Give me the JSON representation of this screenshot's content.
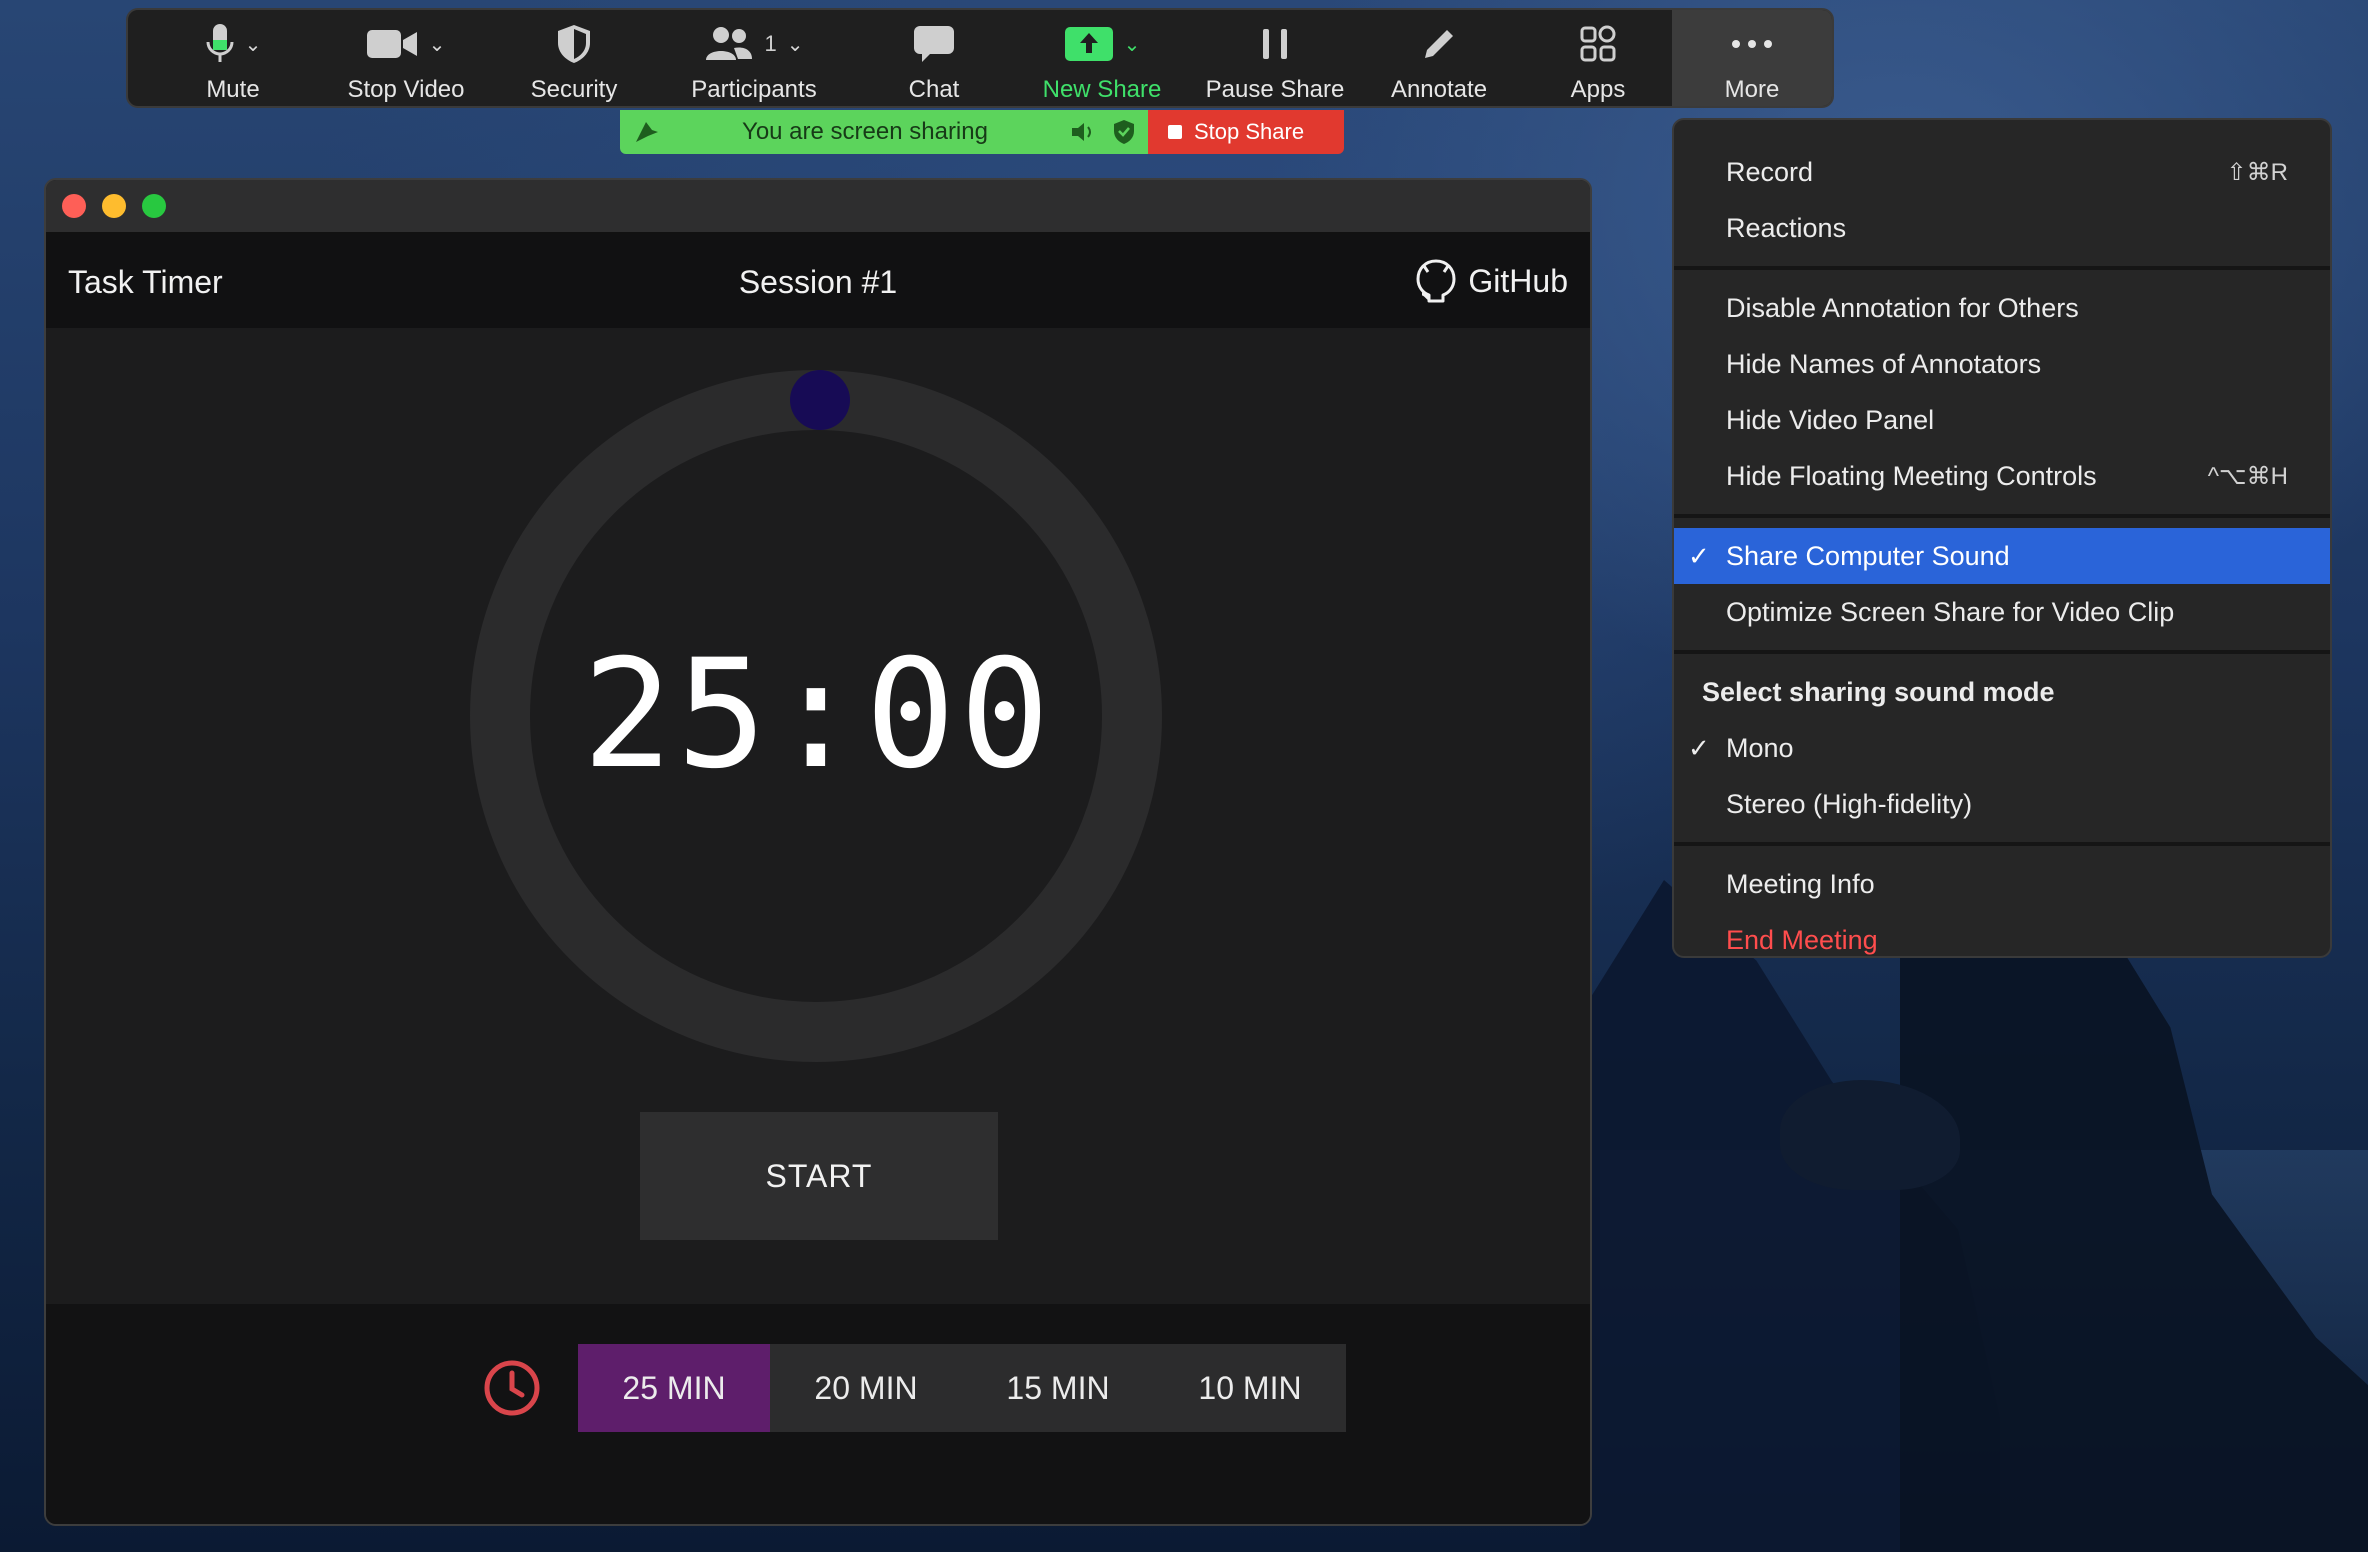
{
  "toolbar": {
    "mute": "Mute",
    "stop_video": "Stop Video",
    "security": "Security",
    "participants": "Participants",
    "participants_count": "1",
    "chat": "Chat",
    "new_share": "New Share",
    "pause_share": "Pause Share",
    "annotate": "Annotate",
    "apps": "Apps",
    "more": "More"
  },
  "share_bar": {
    "message": "You are screen sharing",
    "stop_label": "Stop Share"
  },
  "app": {
    "title": "Task Timer",
    "session": "Session #1",
    "github": "GitHub",
    "time": "25:00",
    "start": "START",
    "presets": [
      "25 MIN",
      "20 MIN",
      "15 MIN",
      "10 MIN"
    ],
    "active_preset": "25 MIN"
  },
  "menu": {
    "record": "Record",
    "record_shortcut": "⇧⌘R",
    "reactions": "Reactions",
    "disable_annotation": "Disable Annotation for Others",
    "hide_names": "Hide Names of Annotators",
    "hide_video_panel": "Hide Video Panel",
    "hide_floating": "Hide Floating Meeting Controls",
    "hide_floating_shortcut": "^⌥⌘H",
    "share_sound": "Share Computer Sound",
    "optimize": "Optimize Screen Share for Video Clip",
    "sound_mode_header": "Select sharing sound mode",
    "mono": "Mono",
    "stereo": "Stereo (High-fidelity)",
    "meeting_info": "Meeting Info",
    "end_meeting": "End Meeting",
    "checkmark": "✓"
  },
  "colors": {
    "share_green": "#5cd45c",
    "stop_red": "#e1392f",
    "menu_highlight": "#2a64d9",
    "active_preset": "#5e1e6b",
    "end_meeting": "#ff4d4d"
  }
}
